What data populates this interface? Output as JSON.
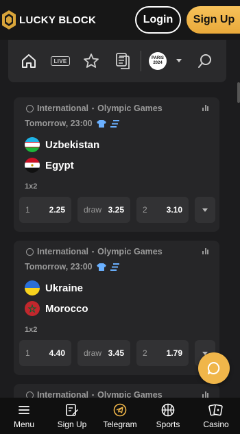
{
  "header": {
    "brand": "LUCKY BLOCK",
    "login_label": "Login",
    "signup_label": "Sign Up"
  },
  "toolbar": {
    "items": [
      "home-icon",
      "live-icon",
      "star-icon",
      "betslip-icon",
      "olympics-icon",
      "search-icon"
    ],
    "live_label": "LIVE",
    "olympic_line1": "PARIS",
    "olympic_line2": "2024"
  },
  "events": [
    {
      "category": "International",
      "competition": "Olympic Games",
      "time": "Tomorrow, 23:00",
      "home": "Uzbekistan",
      "away": "Egypt",
      "market": "1x2",
      "odds": [
        {
          "label": "1",
          "value": "2.25"
        },
        {
          "label": "draw",
          "value": "3.25"
        },
        {
          "label": "2",
          "value": "3.10"
        }
      ]
    },
    {
      "category": "International",
      "competition": "Olympic Games",
      "time": "Tomorrow, 23:00",
      "home": "Ukraine",
      "away": "Morocco",
      "market": "1x2",
      "odds": [
        {
          "label": "1",
          "value": "4.40"
        },
        {
          "label": "draw",
          "value": "3.45"
        },
        {
          "label": "2",
          "value": "1.79"
        }
      ]
    },
    {
      "category": "International",
      "competition": "Olympic Games"
    }
  ],
  "bottom_nav": [
    {
      "label": "Menu",
      "icon": "menu-icon"
    },
    {
      "label": "Sign Up",
      "icon": "signup-icon"
    },
    {
      "label": "Telegram",
      "icon": "telegram-icon"
    },
    {
      "label": "Sports",
      "icon": "sports-icon"
    },
    {
      "label": "Casino",
      "icon": "casino-icon"
    }
  ],
  "colors": {
    "accent": "#f0b64a",
    "background": "#1c1c1e",
    "card": "#262628"
  }
}
